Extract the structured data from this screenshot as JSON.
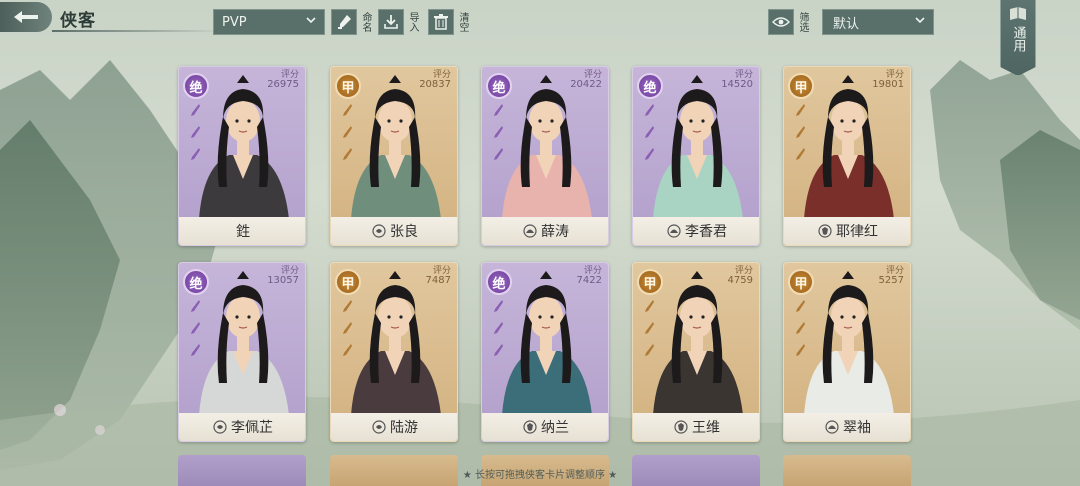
{
  "header": {
    "title": "侠客",
    "mode_value": "PVP",
    "rename_label": "命名",
    "import_label": "导入",
    "clear_label": "清空",
    "filter_label": "筛选",
    "sort_value": "默认",
    "general_label": "通用"
  },
  "score_caption": "评分",
  "cards": [
    {
      "name": "鉎",
      "grade": "绝",
      "tier": "jue",
      "score": "26975",
      "faction": "none"
    },
    {
      "name": "张良",
      "grade": "甲",
      "tier": "jia",
      "score": "20837",
      "faction": "swirl"
    },
    {
      "name": "薛涛",
      "grade": "绝",
      "tier": "jue",
      "score": "20422",
      "faction": "lotus"
    },
    {
      "name": "李香君",
      "grade": "绝",
      "tier": "jue",
      "score": "14520",
      "faction": "lotus"
    },
    {
      "name": "耶律红",
      "grade": "甲",
      "tier": "jia",
      "score": "19801",
      "faction": "shield"
    },
    {
      "name": "李佩芷",
      "grade": "绝",
      "tier": "jue",
      "score": "13057",
      "faction": "swirl"
    },
    {
      "name": "陆游",
      "grade": "甲",
      "tier": "jia",
      "score": "7487",
      "faction": "swirl"
    },
    {
      "name": "纳兰",
      "grade": "绝",
      "tier": "jue",
      "score": "7422",
      "faction": "shield"
    },
    {
      "name": "王维",
      "grade": "甲",
      "tier": "jia",
      "score": "4759",
      "faction": "shield"
    },
    {
      "name": "翠袖",
      "grade": "甲",
      "tier": "jia",
      "score": "5257",
      "faction": "lotus"
    }
  ],
  "hint": "★ 长按可拖拽侠客卡片调整顺序 ★",
  "colors": {
    "jue": "#b8a6d0",
    "jia": "#dcbf92",
    "toolbar": "#59706a"
  }
}
